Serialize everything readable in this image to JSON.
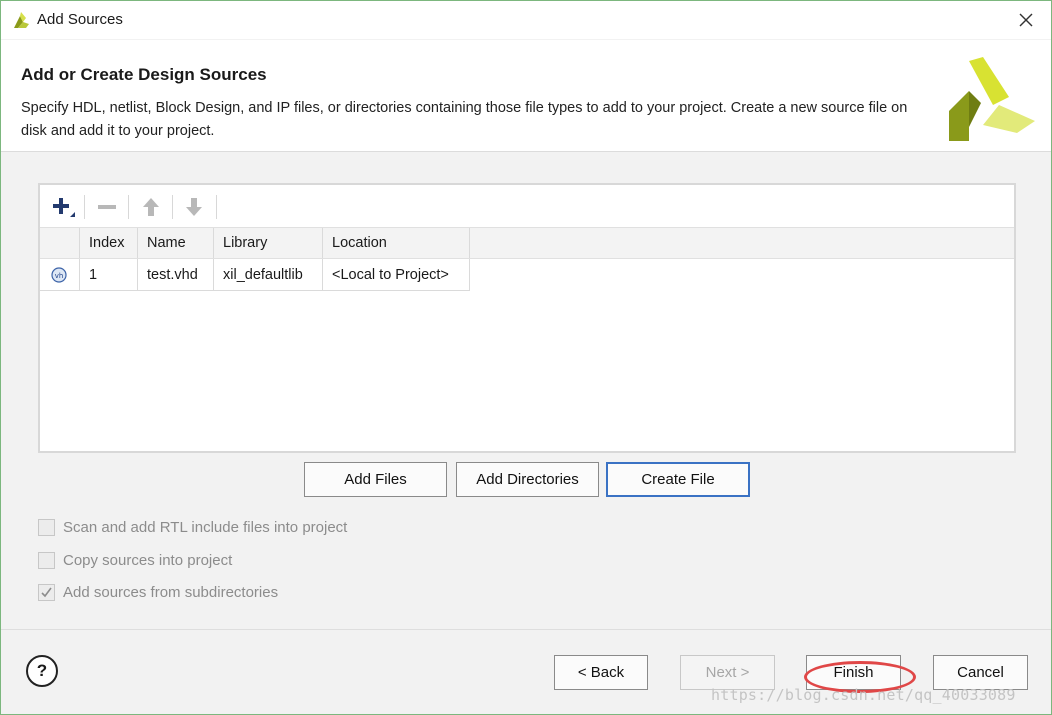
{
  "window": {
    "title": "Add Sources",
    "close_symbol": "✕"
  },
  "header": {
    "title": "Add or Create Design Sources",
    "description": "Specify HDL, netlist, Block Design, and IP files, or directories containing those file types to add to your project. Create a new source file on disk and add it to your project."
  },
  "table": {
    "columns": [
      "Index",
      "Name",
      "Library",
      "Location"
    ],
    "rows": [
      {
        "icon": "vhdl-file-icon",
        "index": "1",
        "name": "test.vhd",
        "library": "xil_defaultlib",
        "location": "<Local to Project>"
      }
    ]
  },
  "actions": {
    "add_files": "Add Files",
    "add_directories": "Add Directories",
    "create_file": "Create File"
  },
  "options": [
    {
      "label": "Scan and add RTL include files into project",
      "checked": false,
      "enabled": false
    },
    {
      "label": "Copy sources into project",
      "checked": false,
      "enabled": false
    },
    {
      "label": "Add sources from subdirectories",
      "checked": true,
      "enabled": false
    }
  ],
  "footer": {
    "help_label": "?",
    "back_label": "< Back",
    "next_label": "Next >",
    "finish_label": "Finish",
    "cancel_label": "Cancel"
  },
  "watermark": "https://blog.csdn.net/qq_40033089",
  "colors": {
    "accent_focus": "#3a72c4",
    "annotation_red": "#e04747",
    "logo_olive": "#8a9a1a",
    "logo_yellow": "#d6e04a"
  }
}
